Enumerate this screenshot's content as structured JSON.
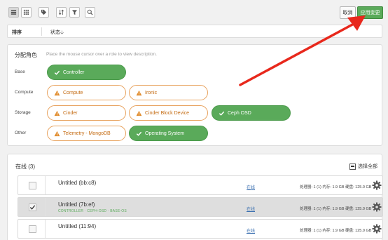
{
  "toolbar": {
    "cancel_label": "取消",
    "apply_label": "应用变更",
    "icons": [
      "list-view-icon",
      "grid-view-icon",
      "tag-icon",
      "sort-icon",
      "filter-icon",
      "search-icon"
    ]
  },
  "sortbar": {
    "sort_label": "排序",
    "status_label": "状态",
    "status_sort_glyph": "🡣"
  },
  "roles": {
    "title": "分配角色",
    "hint": "Place the mouse cursor over a role to view description.",
    "groups": {
      "base": "Base",
      "compute": "Compute",
      "storage": "Storage",
      "other": "Other"
    },
    "items": {
      "controller": "Controller",
      "compute": "Compute",
      "ironic": "Ironic",
      "cinder": "Cinder",
      "cinder_block_device": "Cinder Block Device",
      "ceph_osd": "Ceph OSD",
      "telemetry": "Telemetry - MongoDB",
      "operating_system": "Operating System"
    },
    "colors": {
      "selected": "#5aaa5a",
      "warning_border": "#e8a35f",
      "warning_text": "#c46a10"
    }
  },
  "online": {
    "title": "在线 (3)",
    "select_all_label": "选择全部",
    "nodes": [
      {
        "name": "Untitled (bb:c8)",
        "roles": "",
        "status": "在线",
        "specs": "处理器: 1 (1)  内存: 1.9 GB  硬盘: 125.0 GB",
        "checked": false
      },
      {
        "name": "Untitled (7b:ef)",
        "roles": "CONTROLLER · CEPH-OSD · BASE-OS",
        "status": "在线",
        "specs": "处理器: 1 (1)  内存: 1.9 GB  硬盘: 125.0 GB",
        "checked": true
      },
      {
        "name": "Untitled (11:94)",
        "roles": "",
        "status": "在线",
        "specs": "处理器: 1 (1)  内存: 1.9 GB  硬盘: 125.0 GB",
        "checked": false
      }
    ]
  },
  "annotation": {
    "arrow_color": "#e8281c"
  }
}
